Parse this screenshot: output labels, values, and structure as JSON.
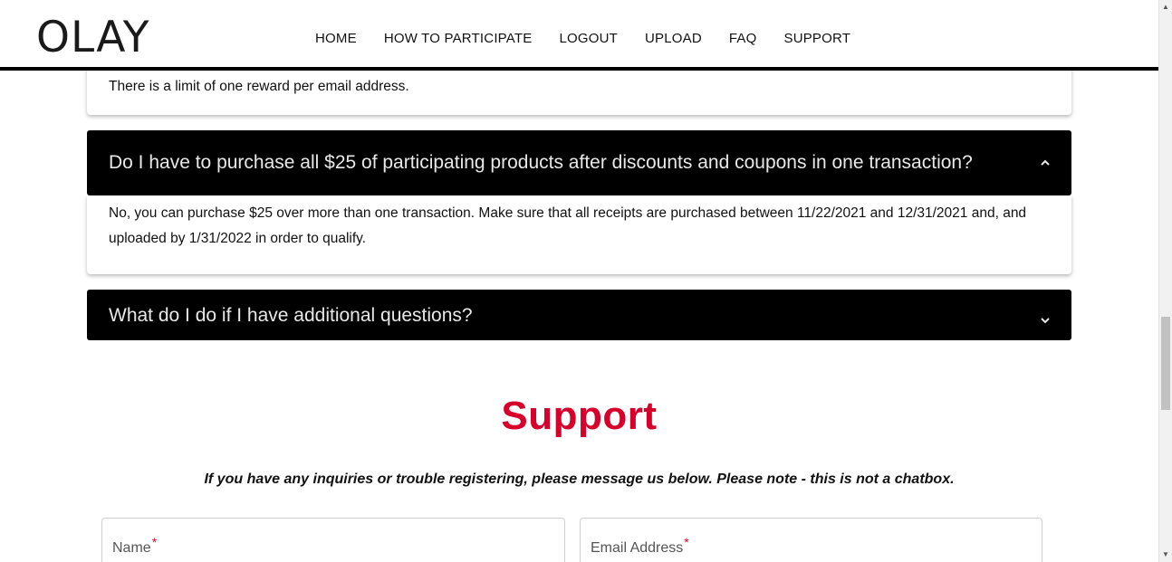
{
  "brand": {
    "logo_text": "OLAY",
    "accent_color": "#d6002a"
  },
  "nav": {
    "items": [
      {
        "label": "HOME"
      },
      {
        "label": "HOW TO PARTICIPATE"
      },
      {
        "label": "LOGOUT"
      },
      {
        "label": "UPLOAD"
      },
      {
        "label": "FAQ"
      },
      {
        "label": "SUPPORT"
      }
    ]
  },
  "faq": {
    "previous_answer": "There is a limit of one reward per email address.",
    "items": [
      {
        "question": "Do I have to purchase all $25 of participating products after discounts and coupons in one transaction?",
        "answer": "No, you can purchase $25 over more than one transaction. Make sure that all receipts are purchased between 11/22/2021 and 12/31/2021 and, and uploaded by 1/31/2022 in order to qualify.",
        "expanded": true,
        "icon": "chevron-up-icon"
      },
      {
        "question": "What do I do if I have additional questions?",
        "expanded": false,
        "icon": "chevron-down-icon"
      }
    ]
  },
  "support": {
    "title": "Support",
    "note": "If you have any inquiries or trouble registering, please message us below. Please note - this is not a chatbox.",
    "fields": {
      "name_label": "Name",
      "email_label": "Email Address",
      "required_mark": "*"
    }
  }
}
